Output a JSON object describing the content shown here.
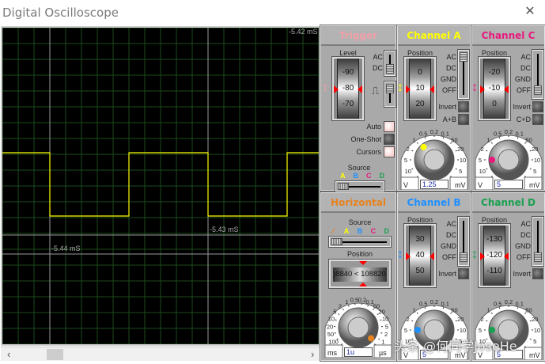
{
  "window": {
    "title": "Digital Oscilloscope",
    "close_icon": "close-icon"
  },
  "screen": {
    "trace_color": "#ffff00",
    "cursor_labels": [
      "-5.42 mS",
      "-5.43 mS",
      "-5.44 mS"
    ],
    "scroll_left": "‹",
    "scroll_right": "›"
  },
  "trigger": {
    "title": "Trigger",
    "color": "#f0a0a8",
    "level_label": "Level",
    "drum": [
      "-100",
      "-90",
      "-80",
      "-70"
    ],
    "coupling": [
      "AC",
      "DC"
    ],
    "auto": "Auto",
    "one_shot": "One-Shot",
    "cursors": "Cursors",
    "source_label": "Source",
    "sources": [
      "A",
      "B",
      "C",
      "D"
    ]
  },
  "horizontal": {
    "title": "Horizontal",
    "color": "#e8821e",
    "source_label": "Source",
    "sources": [
      "A",
      "B",
      "C",
      "D"
    ],
    "position_label": "Position",
    "position_readout": ")8840 < 108820 <",
    "scale": [
      "200",
      "100",
      "50",
      "20",
      "10",
      "5",
      "2",
      "1",
      "0.5",
      "0.2",
      "0.1",
      "50",
      "20",
      "10",
      "5",
      "2",
      "1",
      "0.5"
    ],
    "unit_left": "ms",
    "unit_right": "µs",
    "value": "1u"
  },
  "source_colors": {
    "A": "#ffff00",
    "B": "#1e90ff",
    "C": "#e8197d",
    "D": "#1aa050"
  },
  "channels": [
    {
      "id": "a",
      "title": "Channel A",
      "color": "#ffff00",
      "position_label": "Position",
      "drum": [
        "-10",
        "0",
        "10",
        "20"
      ],
      "coupling": [
        "AC",
        "DC",
        "GND",
        "OFF"
      ],
      "invert": "Invert",
      "combine": "A+B",
      "scale": [
        "20",
        "10",
        "5",
        "2",
        "1",
        "0.5",
        "0.2",
        "0.1",
        "50",
        "20",
        "10",
        "5",
        "2"
      ],
      "unit_left": "V",
      "unit_right": "mV",
      "value": "1.25"
    },
    {
      "id": "c",
      "title": "Channel C",
      "color": "#e8197d",
      "position_label": "Position",
      "drum": [
        "-30",
        "-20",
        "-10",
        "0"
      ],
      "coupling": [
        "AC",
        "DC",
        "GND",
        "OFF"
      ],
      "invert": "Invert",
      "combine": "C+D",
      "scale": [
        "20",
        "10",
        "5",
        "2",
        "1",
        "0.5",
        "0.2",
        "0.1",
        "50",
        "20",
        "10",
        "5",
        "2"
      ],
      "unit_left": "V",
      "unit_right": "mV",
      "value": "5"
    },
    {
      "id": "b",
      "title": "Channel B",
      "color": "#1e90ff",
      "position_label": "Position",
      "drum": [
        "30",
        "40",
        "50"
      ],
      "coupling": [
        "AC",
        "DC",
        "GND",
        "OFF"
      ],
      "invert": "Invert",
      "scale": [
        "20",
        "10",
        "5",
        "2",
        "1",
        "0.5",
        "0.2",
        "0.1",
        "50",
        "20",
        "10",
        "5",
        "2"
      ],
      "unit_left": "V",
      "unit_right": "mV",
      "value": "5"
    },
    {
      "id": "d",
      "title": "Channel D",
      "color": "#1aa050",
      "position_label": "Position",
      "drum": [
        "-130",
        "-120",
        "-110"
      ],
      "coupling": [
        "AC",
        "DC",
        "GND",
        "OFF"
      ],
      "invert": "Invert",
      "scale": [
        "20",
        "10",
        "5",
        "2",
        "1",
        "0.5",
        "0.2",
        "0.1",
        "50",
        "20",
        "10",
        "5",
        "2"
      ],
      "unit_left": "V",
      "unit_right": "mV",
      "value": "5"
    }
  ],
  "watermark": "头条 @何同学JoseHe"
}
